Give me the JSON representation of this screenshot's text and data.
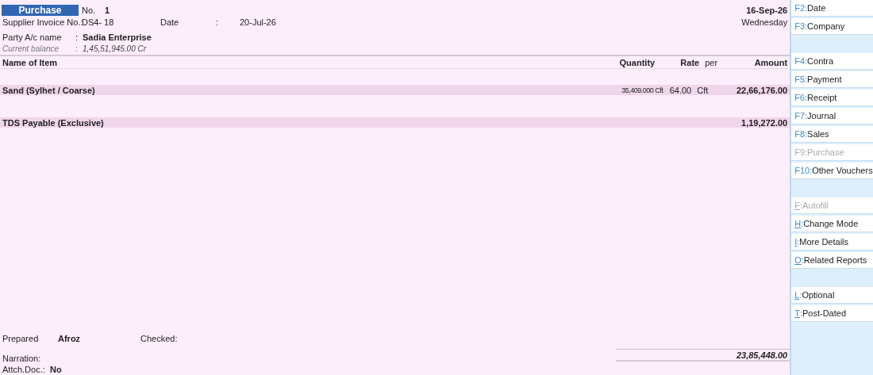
{
  "voucher": {
    "type": "Purchase",
    "no_label": "No.",
    "no": "1",
    "invoice_label": "Supplier Invoice No.:",
    "invoice_no": "DS4- 18",
    "date_label": "Date",
    "date_sep": ":",
    "date": "20-Jul-26",
    "current_date": "16-Sep-26",
    "weekday": "Wednesday"
  },
  "party": {
    "label": "Party A/c name",
    "sep": ":",
    "name": "Sadia Enterprise",
    "balance_label": "Current balance",
    "balance_sep": ":",
    "balance": "1,45,51,945.00 Cr"
  },
  "table": {
    "columns": [
      "Name of Item",
      "Quantity",
      "Rate",
      "per",
      "Amount"
    ],
    "rows": [
      {
        "kind": "item",
        "name": "Sand (Sylhet / Coarse)",
        "quantity": "35,409.000 Cft",
        "rate": "64.00",
        "per": "Cft",
        "amount": "22,66,176.00"
      },
      {
        "kind": "ledger",
        "name": "TDS Payable (Exclusive)",
        "amount": "1,19,272.00"
      }
    ]
  },
  "footer": {
    "prepared_label": "Prepared",
    "prepared_by": "Afroz",
    "checked_label": "Checked:",
    "narration_label": "Narration:",
    "total": "23,85,448.00",
    "attach_label": "Attch.Doc.:",
    "attach_value": "No"
  },
  "sidebar": {
    "items": [
      {
        "kind": "fkey",
        "key": "F2:",
        "label": "Date",
        "disabled": false
      },
      {
        "kind": "fkey",
        "key": "F3:",
        "label": "Company",
        "disabled": false
      },
      {
        "kind": "gap"
      },
      {
        "kind": "fkey",
        "key": "F4:",
        "label": "Contra",
        "disabled": false
      },
      {
        "kind": "fkey",
        "key": "F5:",
        "label": "Payment",
        "disabled": false
      },
      {
        "kind": "fkey",
        "key": "F6:",
        "label": "Receipt",
        "disabled": false
      },
      {
        "kind": "fkey",
        "key": "F7:",
        "label": "Journal",
        "disabled": false
      },
      {
        "kind": "fkey",
        "key": "F8:",
        "label": "Sales",
        "disabled": false
      },
      {
        "kind": "fkey",
        "key": "F9:",
        "label": "Purchase",
        "disabled": true
      },
      {
        "kind": "fkey",
        "key": "F10:",
        "label": "Other Vouchers",
        "disabled": false
      },
      {
        "kind": "gap"
      },
      {
        "kind": "letter",
        "key": "F",
        "sep": ":",
        "label": "Autofill",
        "disabled": true
      },
      {
        "kind": "letter",
        "key": "H",
        "sep": ":",
        "label": "Change Mode",
        "disabled": false
      },
      {
        "kind": "letter",
        "key": "I",
        "sep": ":",
        "label": "More Details",
        "disabled": false
      },
      {
        "kind": "letter",
        "key": "O",
        "sep": ":",
        "label": "Related Reports",
        "disabled": false
      },
      {
        "kind": "gap"
      },
      {
        "kind": "letter",
        "key": "L",
        "sep": ":",
        "label": "Optional",
        "disabled": false
      },
      {
        "kind": "letter",
        "key": "T",
        "sep": ":",
        "label": "Post-Dated",
        "disabled": false
      }
    ]
  }
}
